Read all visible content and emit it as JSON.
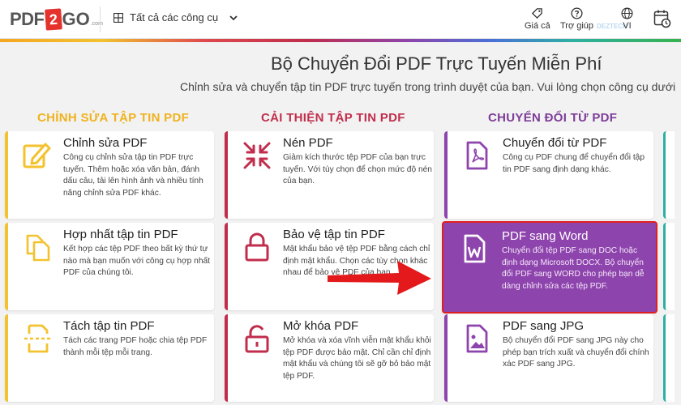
{
  "header": {
    "logo_left": "PDF",
    "logo_mid": "2",
    "logo_right": "GO",
    "logo_suffix": ".com",
    "tools_menu": "Tất cả các công cụ",
    "price": "Giá cả",
    "help": "Trợ giúp",
    "lang": "VI",
    "watermark": "DEZTECH"
  },
  "hero": {
    "title": "Bộ Chuyển Đổi PDF Trực Tuyến Miễn Phí",
    "subtitle": "Chỉnh sửa và chuyển tập tin PDF trực tuyến trong trình duyệt của bạn. Vui lòng chọn công cụ dưới"
  },
  "columns": [
    {
      "heading": "CHỈNH SỬA TẬP TIN PDF",
      "cards": [
        {
          "title": "Chỉnh sửa PDF",
          "desc": "Công cụ chỉnh sửa tập tin PDF trực tuyến. Thêm hoặc xóa văn bản, đánh dấu câu, tải lên hình ảnh và nhiều tính năng chỉnh sửa PDF khác.",
          "icon": "edit-icon"
        },
        {
          "title": "Hợp nhất tập tin PDF",
          "desc": "Kết hợp các tệp PDF theo bất kỳ thứ tự nào mà bạn muốn với công cụ hợp nhất PDF của chúng tôi.",
          "icon": "merge-icon"
        },
        {
          "title": "Tách tập tin PDF",
          "desc": "Tách các trang PDF hoặc chia tệp PDF thành mỗi tệp mỗi trang.",
          "icon": "split-icon"
        }
      ]
    },
    {
      "heading": "CẢI THIỆN TẬP TIN PDF",
      "cards": [
        {
          "title": "Nén PDF",
          "desc": "Giảm kích thước tệp PDF của bạn trực tuyến. Với tùy chọn để chọn mức độ nén của bạn.",
          "icon": "compress-icon"
        },
        {
          "title": "Bảo vệ tập tin PDF",
          "desc": "Mật khẩu bảo vệ tệp PDF bằng cách chỉ định mật khẩu. Chọn các tùy chọn khác nhau để bảo vệ PDF của bạn.",
          "icon": "lock-icon"
        },
        {
          "title": "Mở khóa PDF",
          "desc": "Mở khóa và xóa vĩnh viễn mật khẩu khỏi tệp PDF được bảo mật. Chỉ cần chỉ định mật khẩu và chúng tôi sẽ gỡ bỏ bảo mật tệp PDF.",
          "icon": "unlock-icon"
        }
      ]
    },
    {
      "heading": "CHUYỂN ĐỔI TỪ PDF",
      "cards": [
        {
          "title": "Chuyển đổi từ PDF",
          "desc": "Công cụ PDF chung để chuyển đổi tập tin PDF sang định dạng khác.",
          "icon": "pdf-file-icon"
        },
        {
          "title": "PDF sang Word",
          "desc": "Chuyển đổi tệp PDF sang DOC hoặc định dạng Microsoft DOCX. Bộ chuyển đổi PDF sang WORD cho phép bạn dễ dàng chỉnh sửa các tệp PDF.",
          "icon": "word-file-icon"
        },
        {
          "title": "PDF sang JPG",
          "desc": "Bộ chuyển đổi PDF sang JPG này cho phép bạn trích xuất và chuyển đổi chính xác PDF sang JPG.",
          "icon": "image-file-icon"
        }
      ]
    }
  ],
  "colors": {
    "edit": "#f3c22e",
    "optimize": "#c12d4c",
    "convert": "#8e44ad",
    "highlight": "#e02020"
  }
}
